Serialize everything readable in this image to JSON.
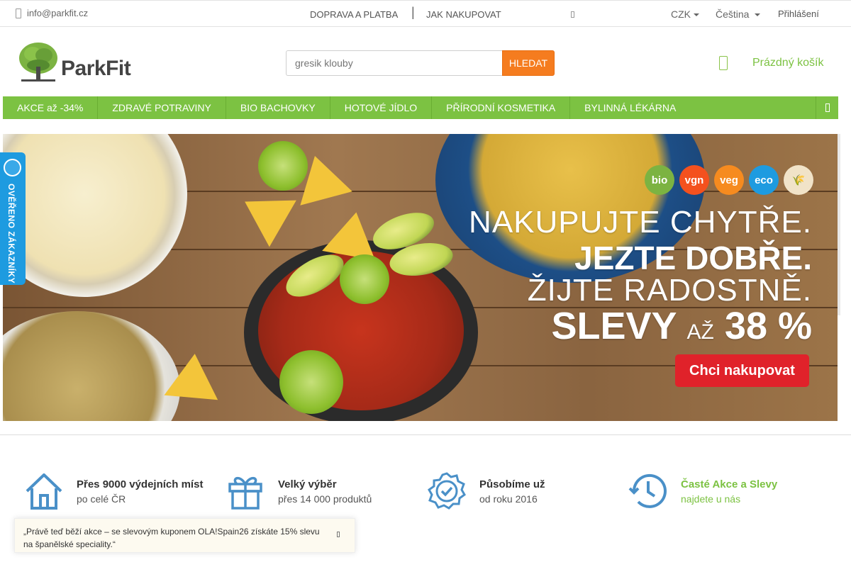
{
  "topbar": {
    "email": "info@parkfit.cz",
    "link_shipping": "DOPRAVA A PLATBA",
    "separator": "|",
    "link_howto": "JAK NAKUPOVAT",
    "currency": "CZK",
    "language": "Čeština",
    "login": "Přihlášení"
  },
  "brand": {
    "logo_text": "ParkFit"
  },
  "search": {
    "placeholder": "gresik klouby",
    "button": "HLEDAT"
  },
  "cart": {
    "label": "Prázdný košík"
  },
  "nav": {
    "items": [
      "AKCE až -34%",
      "ZDRAVÉ POTRAVINY",
      "BIO BACHOVKY",
      "HOTOVÉ JÍDLO",
      "PŘÍRODNÍ KOSMETIKA",
      "BYLINNÁ LÉKÁRNA"
    ]
  },
  "banner": {
    "badges": [
      "bio",
      "vgn",
      "veg",
      "eco",
      "🌾"
    ],
    "line1": "NAKUPUJTE CHYTŘE.",
    "line2": "JEZTE DOBŘE.",
    "line3": "ŽIJTE RADOSTNĚ.",
    "line4_a": "SLEVY",
    "line4_b": "AŽ",
    "line4_c": "38 %",
    "cta": "Chci nakupovat"
  },
  "verified": {
    "label": "OVĚŘENO ZÁKAZNÍKY"
  },
  "features": [
    {
      "title": "Přes 9000 výdejních míst",
      "subtitle": "po celé ČR",
      "icon": "house-icon"
    },
    {
      "title": "Velký výběr",
      "subtitle": "přes 14 000 produktů",
      "icon": "gift-icon"
    },
    {
      "title": "Působíme už",
      "subtitle": "od roku 2016",
      "icon": "check-badge-icon"
    },
    {
      "title": "Časté Akce a Slevy",
      "subtitle": "najdete u nás",
      "icon": "clock-history-icon"
    }
  ],
  "toast": {
    "text": "„Právě teď běží akce – se slevovým kuponem OLA!Spain26 získáte 15% slevu na španělské speciality.“"
  },
  "colors": {
    "green": "#7cc242",
    "orange": "#f57c1f",
    "red": "#e0222a",
    "blue": "#1e9be0"
  }
}
